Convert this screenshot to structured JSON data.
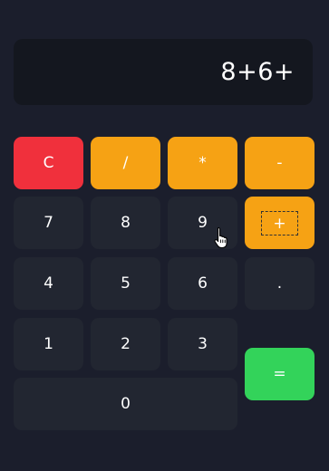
{
  "display": {
    "expression": "8+6+"
  },
  "keys": {
    "clear": "C",
    "divide": "/",
    "multiply": "*",
    "subtract": "-",
    "seven": "7",
    "eight": "8",
    "nine": "9",
    "add": "+",
    "four": "4",
    "five": "5",
    "six": "6",
    "decimal": ".",
    "one": "1",
    "two": "2",
    "three": "3",
    "equals": "=",
    "zero": "0"
  },
  "colors": {
    "background": "#1b1e2c",
    "display": "#14171f",
    "number_key": "#222631",
    "clear_key": "#f0303c",
    "operator_key": "#f6a214",
    "equals_key": "#33d35a"
  },
  "cursor": {
    "icon": "hand-pointer-icon"
  }
}
